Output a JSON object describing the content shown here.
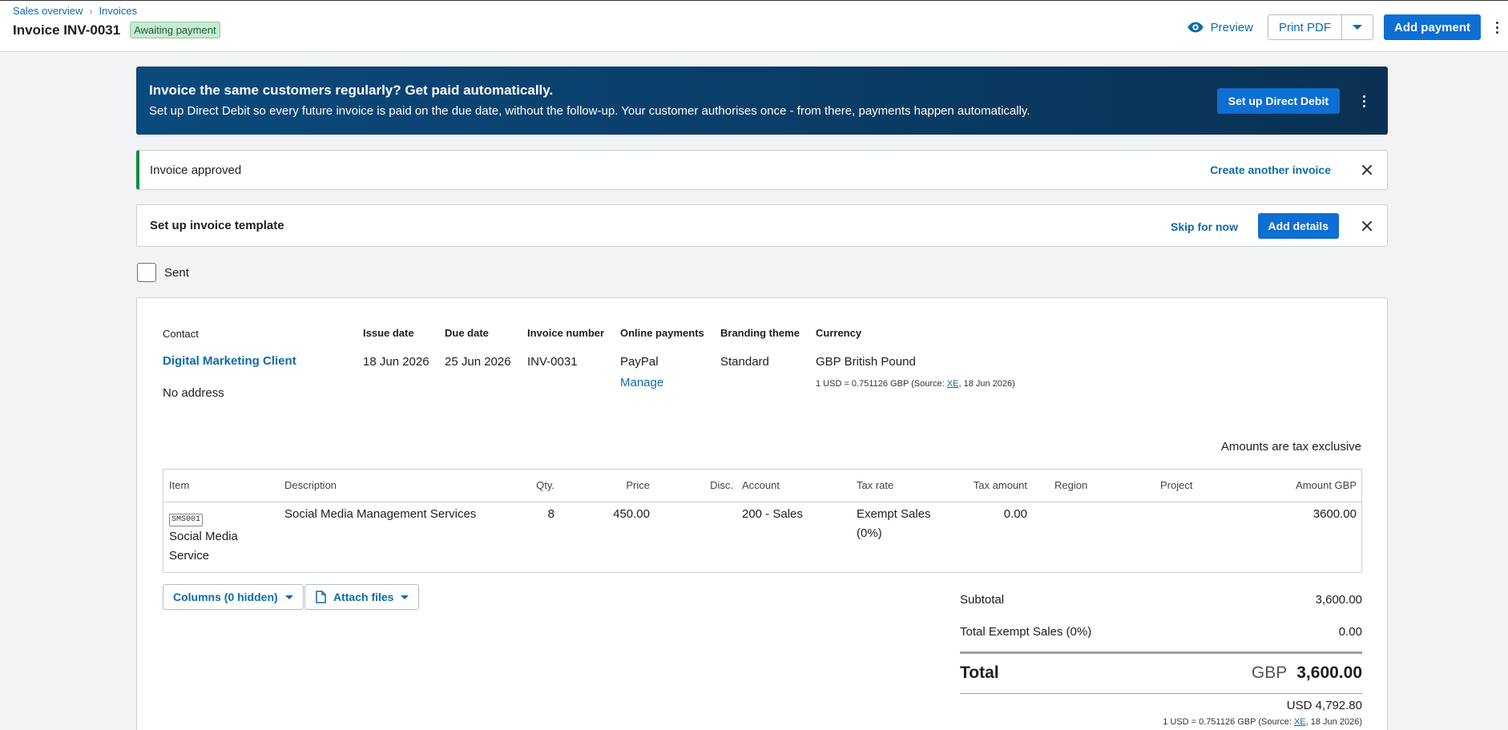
{
  "breadcrumb": {
    "parent": "Sales overview",
    "current": "Invoices"
  },
  "header": {
    "title": "Invoice INV-0031",
    "status": "Awaiting payment",
    "preview_label": "Preview",
    "print_label": "Print PDF",
    "add_payment_label": "Add payment"
  },
  "banner": {
    "title": "Invoice the same customers regularly? Get paid automatically.",
    "text": "Set up Direct Debit so every future invoice is paid on the due date, without the follow-up. Your customer authorises once - from there, payments happen automatically.",
    "button": "Set up Direct Debit"
  },
  "approved_alert": {
    "message": "Invoice approved",
    "link": "Create another invoice"
  },
  "template_alert": {
    "message": "Set up invoice template",
    "skip": "Skip for now",
    "button": "Add details"
  },
  "sent": {
    "label": "Sent",
    "checked": false
  },
  "invoice": {
    "contact_label": "Contact",
    "contact_name": "Digital Marketing Client",
    "address": "No address",
    "issue_date_label": "Issue date",
    "issue_date": "18 Jun 2026",
    "due_date_label": "Due date",
    "due_date": "25 Jun 2026",
    "number_label": "Invoice number",
    "number": "INV-0031",
    "online_payments_label": "Online payments",
    "online_payments": "PayPal",
    "manage": "Manage",
    "branding_label": "Branding theme",
    "branding": "Standard",
    "currency_label": "Currency",
    "currency": "GBP British Pound",
    "rate_prefix": "1 USD = 0.751126 GBP (Source: ",
    "rate_source": "XE",
    "rate_suffix": ", 18 Jun 2026)",
    "tax_note": "Amounts are tax exclusive"
  },
  "table": {
    "headers": {
      "item": "Item",
      "description": "Description",
      "qty": "Qty.",
      "price": "Price",
      "disc": "Disc.",
      "account": "Account",
      "tax_rate": "Tax rate",
      "tax_amount": "Tax amount",
      "region": "Region",
      "project": "Project",
      "amount": "Amount GBP"
    },
    "rows": [
      {
        "code": "SMS001",
        "item_name": "Social Media Service",
        "description": "Social Media Management Services",
        "qty": "8",
        "price": "450.00",
        "disc": "",
        "account": "200 - Sales",
        "tax_rate": "Exempt Sales (0%)",
        "tax_amount": "0.00",
        "region": "",
        "project": "",
        "amount": "3600.00"
      }
    ]
  },
  "buttons": {
    "columns": "Columns (0 hidden)",
    "attach": "Attach files"
  },
  "totals": {
    "subtotal_label": "Subtotal",
    "subtotal": "3,600.00",
    "exempt_label": "Total Exempt Sales (0%)",
    "exempt": "0.00",
    "total_label": "Total",
    "total_currency": "GBP",
    "total": "3,600.00",
    "usd": "USD 4,792.80",
    "rate_prefix": "1 USD = 0.751126 GBP (Source: ",
    "rate_source": "XE",
    "rate_suffix": ", 18 Jun 2026)"
  },
  "colors": {
    "primary": "#0d6ed3",
    "link": "#0d6ba8",
    "banner": "#0a3d66",
    "success": "#138a3f"
  },
  "icons": [
    "eye-icon",
    "chevron-right-icon",
    "caret-down-icon",
    "kebab-icon",
    "close-icon",
    "document-icon"
  ]
}
